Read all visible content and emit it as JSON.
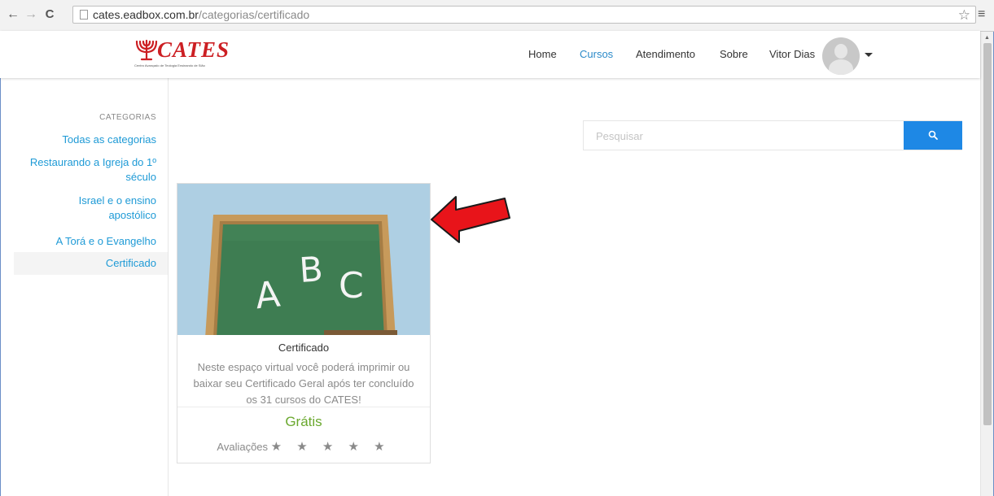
{
  "browser": {
    "back_glyph": "←",
    "forward_glyph": "→",
    "reload_glyph": "C",
    "url_host": "cates.eadbox.com.br",
    "url_path": "/categorias/certificado",
    "bookmark_glyph": "☆",
    "menu_glyph": "≡"
  },
  "header": {
    "logo_text": "CATES",
    "logo_subtitle": "Centro Avançado de Teologia Ensinando de Sião",
    "nav": {
      "home": "Home",
      "cursos": "Cursos",
      "atendimento": "Atendimento",
      "sobre": "Sobre"
    },
    "user_name": "Vitor Dias"
  },
  "sidebar": {
    "heading": "CATEGORIAS",
    "items": [
      {
        "line1": "Todas as categorias",
        "line2": ""
      },
      {
        "line1": "Restaurando a Igreja do 1º",
        "line2": "século"
      },
      {
        "line1": "Israel e o ensino",
        "line2": "apostólico"
      },
      {
        "line1": "A Torá e o Evangelho",
        "line2": ""
      },
      {
        "line1": "Certificado",
        "line2": ""
      }
    ],
    "selected_index": 4
  },
  "search": {
    "placeholder": "Pesquisar"
  },
  "course": {
    "image_letters": [
      "A",
      "B",
      "C"
    ],
    "title": "Certificado",
    "description": "Neste espaço virtual você poderá imprimir ou baixar seu Certificado Geral após ter concluído os 31 cursos do CATES!",
    "price": "Grátis",
    "rating_label": "Avaliações",
    "stars": "★ ★ ★ ★ ★",
    "rating_value": 0
  },
  "colors": {
    "accent": "#1e88e5",
    "link": "#1e9ad6",
    "price": "#6aa82e",
    "logo": "#cc1f23",
    "annotation": "#e8141a"
  }
}
